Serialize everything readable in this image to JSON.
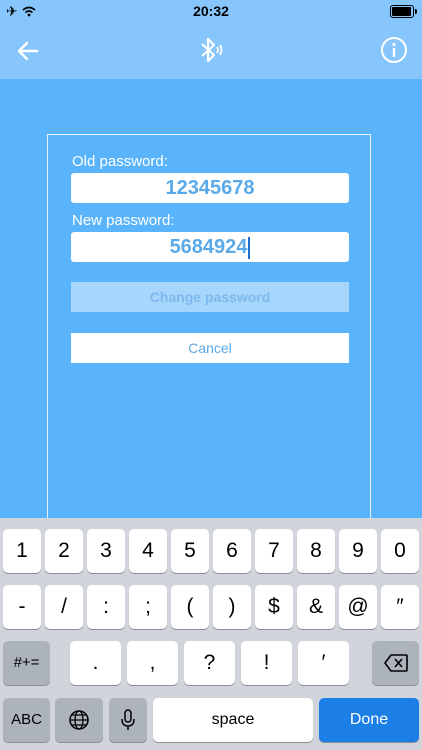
{
  "status_bar": {
    "time": "20:32",
    "left_icons": [
      "airplane-icon",
      "wifi-icon"
    ],
    "battery_level": 0.95
  },
  "nav": {
    "back_icon": "arrow-left-icon",
    "center_icon": "bluetooth-icon",
    "info_icon": "info-icon"
  },
  "form": {
    "old_password_label": "Old password:",
    "old_password_value": "12345678",
    "new_password_label": "New password:",
    "new_password_value": "5684924",
    "change_button": "Change password",
    "cancel_button": "Cancel"
  },
  "keyboard": {
    "row1": [
      "1",
      "2",
      "3",
      "4",
      "5",
      "6",
      "7",
      "8",
      "9",
      "0"
    ],
    "row2": [
      "-",
      "/",
      ":",
      ";",
      "(",
      ")",
      "$",
      "&",
      "@",
      "″"
    ],
    "row3": {
      "toggle": "#+=",
      "keys": [
        ".",
        ",",
        "?",
        "!",
        "′"
      ],
      "delete_icon": "backspace-icon"
    },
    "row4": {
      "abc": "ABC",
      "globe_icon": "globe-icon",
      "mic_icon": "microphone-icon",
      "space": "space",
      "done": "Done"
    }
  },
  "colors": {
    "background": "#5ab4fb",
    "nav": "#86c6fc",
    "accent": "#1b7fe6"
  }
}
